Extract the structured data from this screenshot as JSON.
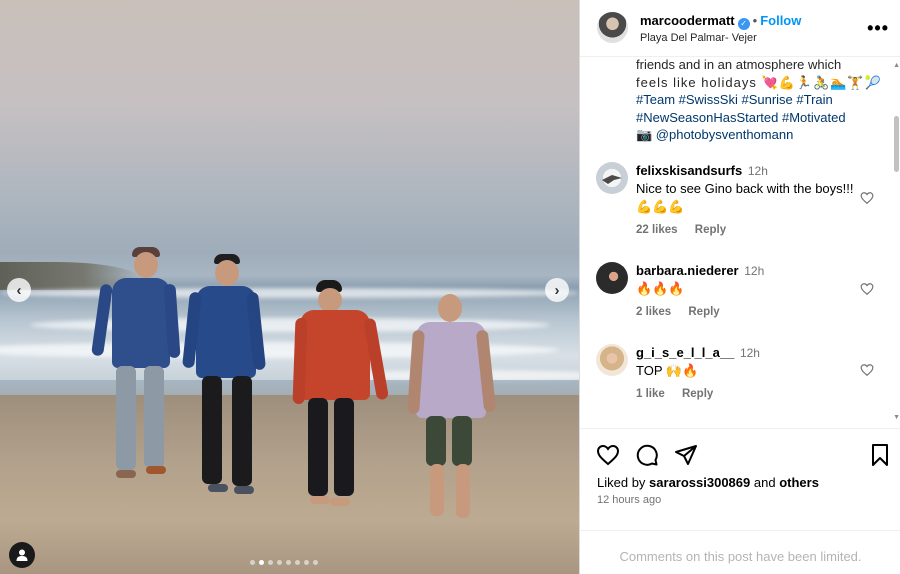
{
  "post": {
    "username": "marcoodermatt",
    "follow_label": "Follow",
    "location": "Playa Del Palmar- Vejer",
    "more_label": "•••"
  },
  "caption": {
    "line1": "friends and in an atmosphere which",
    "line2": "feels like holidays 💘💪🏃🚴🏊🏋️🎾",
    "hashtags_line1": "#Team #SwissSki #Sunrise #Train",
    "hashtags_line2": "#NewSeasonHasStarted #Motivated",
    "photo_credit": "📷 @photobysventhomann"
  },
  "comments": [
    {
      "user": "felixskisandsurfs",
      "time": "12h",
      "text": "Nice to see Gino back with the boys!!!💪💪💪",
      "likes": "22 likes",
      "reply": "Reply"
    },
    {
      "user": "barbara.niederer",
      "time": "12h",
      "text": "🔥🔥🔥",
      "likes": "2 likes",
      "reply": "Reply"
    },
    {
      "user": "g_i_s_e_l_l_a__",
      "time": "12h",
      "text": "TOP 🙌🔥",
      "likes": "1 like",
      "reply": "Reply"
    }
  ],
  "likes": {
    "prefix": "Liked by",
    "user": "sararossi300869",
    "and": "and",
    "others": "others"
  },
  "time_ago": "12 hours ago",
  "comments_limited": "Comments on this post have been limited.",
  "carousel": {
    "total_slides": 8,
    "active_index": 1
  },
  "colors": {
    "link": "#00376b",
    "follow": "#0095f6",
    "muted": "#737373",
    "verified": "#3897f0"
  },
  "icons": [
    "chevron-left-icon",
    "chevron-right-icon",
    "user-tag-icon",
    "verified-badge-icon",
    "more-options-icon",
    "heart-icon",
    "comment-icon",
    "share-icon",
    "bookmark-icon"
  ]
}
